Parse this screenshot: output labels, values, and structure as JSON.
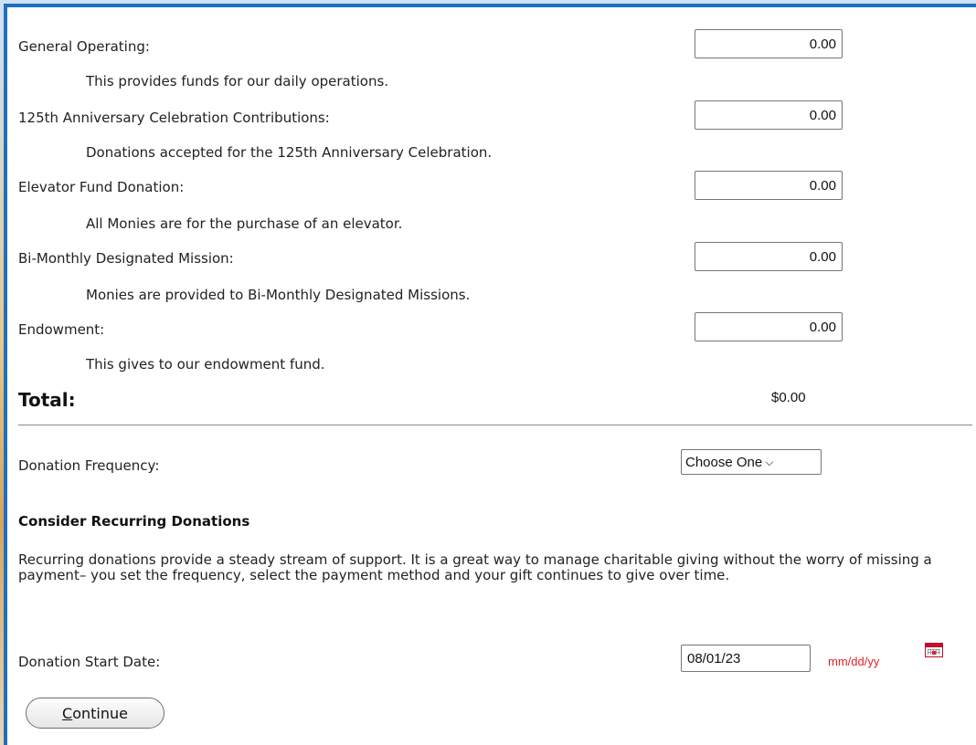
{
  "funds": [
    {
      "label": "General Operating:",
      "description": "This provides funds for our daily operations.",
      "amount": "0.00"
    },
    {
      "label": "125th Anniversary Celebration Contributions:",
      "description": "Donations accepted for the 125th Anniversary Celebration.",
      "amount": "0.00"
    },
    {
      "label": "Elevator Fund Donation:",
      "description": "All Monies are for the purchase of an elevator.",
      "amount": "0.00"
    },
    {
      "label": "Bi-Monthly Designated Mission:",
      "description": "Monies are provided to Bi-Monthly Designated Missions.",
      "amount": "0.00"
    },
    {
      "label": "Endowment:",
      "description": "This gives to our endowment fund.",
      "amount": "0.00"
    }
  ],
  "total": {
    "label": "Total:",
    "value": "$0.00"
  },
  "frequency": {
    "label": "Donation Frequency:",
    "selected": "Choose One"
  },
  "recurring": {
    "heading": "Consider Recurring Donations",
    "text": "Recurring donations provide a steady stream of support. It is a great way to manage charitable giving without the worry of missing a payment– you set the frequency, select the payment method and your gift continues to give over time."
  },
  "start_date": {
    "label": "Donation Start Date:",
    "value": "08/01/23",
    "format_hint": "mm/dd/yy"
  },
  "continue_button": {
    "label_first": "C",
    "label_rest": "ontinue"
  },
  "colors": {
    "frame_border": "#1f6fc0",
    "hint_red": "#e4202b"
  }
}
